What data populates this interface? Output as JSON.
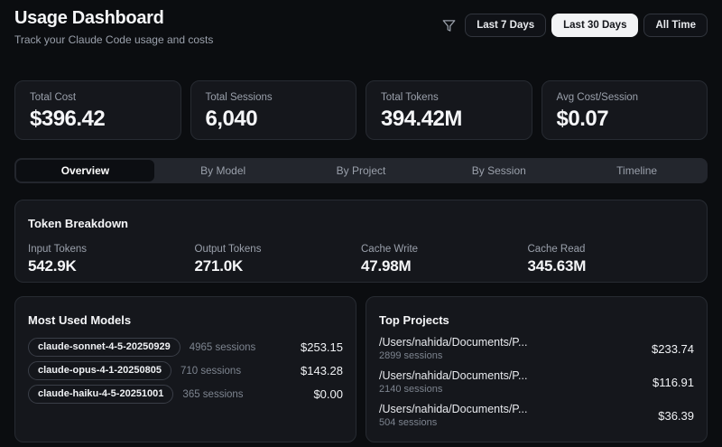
{
  "header": {
    "title": "Usage Dashboard",
    "subtitle": "Track your Claude Code usage and costs",
    "filter_icon": "funnel-filter-icon",
    "filters": [
      {
        "label": "Last 7 Days",
        "active": false
      },
      {
        "label": "Last 30 Days",
        "active": true
      },
      {
        "label": "All Time",
        "active": false
      }
    ]
  },
  "stats": [
    {
      "label": "Total Cost",
      "value": "$396.42"
    },
    {
      "label": "Total Sessions",
      "value": "6,040"
    },
    {
      "label": "Total Tokens",
      "value": "394.42M"
    },
    {
      "label": "Avg Cost/Session",
      "value": "$0.07"
    }
  ],
  "tabs": [
    {
      "label": "Overview",
      "active": true
    },
    {
      "label": "By Model",
      "active": false
    },
    {
      "label": "By Project",
      "active": false
    },
    {
      "label": "By Session",
      "active": false
    },
    {
      "label": "Timeline",
      "active": false
    }
  ],
  "token_breakdown": {
    "title": "Token Breakdown",
    "items": [
      {
        "label": "Input Tokens",
        "value": "542.9K"
      },
      {
        "label": "Output Tokens",
        "value": "271.0K"
      },
      {
        "label": "Cache Write",
        "value": "47.98M"
      },
      {
        "label": "Cache Read",
        "value": "345.63M"
      }
    ]
  },
  "most_used_models": {
    "title": "Most Used Models",
    "rows": [
      {
        "model": "claude-sonnet-4-5-20250929",
        "sessions": "4965 sessions",
        "cost": "$253.15"
      },
      {
        "model": "claude-opus-4-1-20250805",
        "sessions": "710 sessions",
        "cost": "$143.28"
      },
      {
        "model": "claude-haiku-4-5-20251001",
        "sessions": "365 sessions",
        "cost": "$0.00"
      }
    ]
  },
  "top_projects": {
    "title": "Top Projects",
    "rows": [
      {
        "path": "/Users/nahida/Documents/P...",
        "sessions": "2899 sessions",
        "cost": "$233.74"
      },
      {
        "path": "/Users/nahida/Documents/P...",
        "sessions": "2140 sessions",
        "cost": "$116.91"
      },
      {
        "path": "/Users/nahida/Documents/P...",
        "sessions": "504 sessions",
        "cost": "$36.39"
      }
    ]
  },
  "colors": {
    "page_background": "#0b0d10",
    "card_background": "#15171c",
    "card_border": "#272b32",
    "tabbar_background": "#23262d",
    "selected_tab_background": "#0c0e12",
    "active_filter_background": "#f2f3f5",
    "muted_text": "#9aa0ab",
    "primary_text": "#f5f6f8"
  }
}
